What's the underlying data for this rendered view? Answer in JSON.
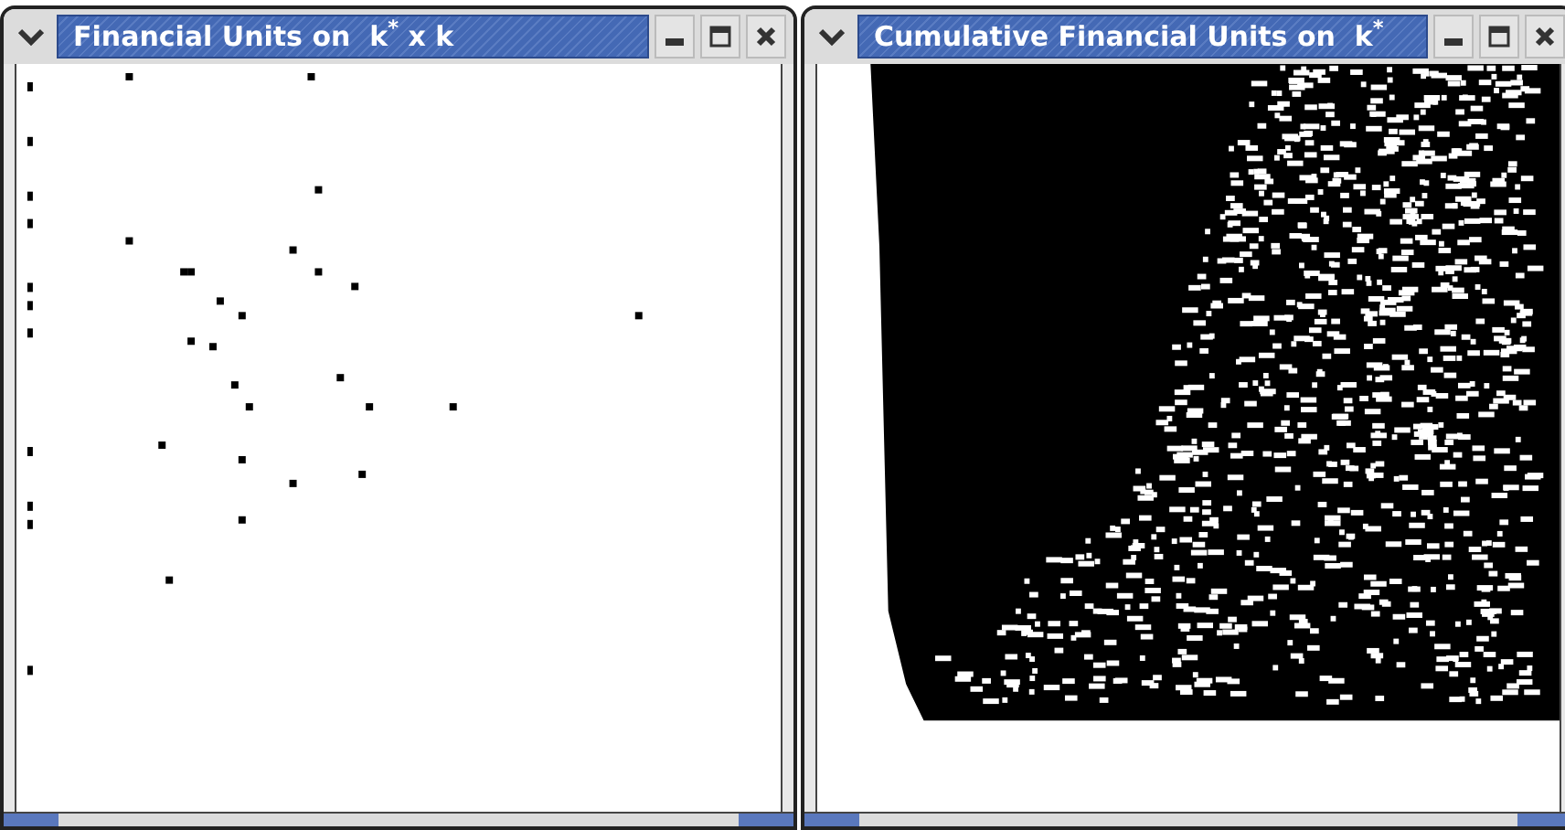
{
  "windows": [
    {
      "title": "Financial Units on  k$^{*}$ x k",
      "kind": "sparse"
    },
    {
      "title": "Cumulative Financial Units on  k$^{*}$",
      "kind": "dense"
    }
  ]
}
